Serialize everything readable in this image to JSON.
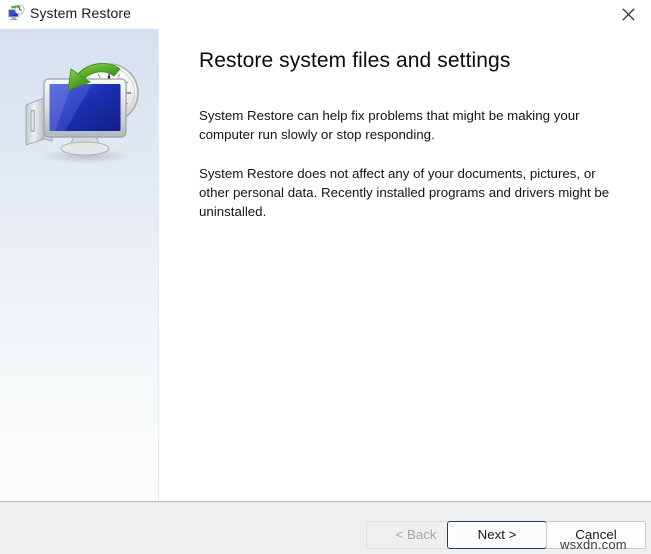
{
  "window": {
    "title": "System Restore",
    "icon": "system-restore-icon",
    "close_label": "✕"
  },
  "sidebar": {
    "illustration": "computer-monitor-clock-restore-illustration"
  },
  "main": {
    "heading": "Restore system files and settings",
    "paragraphs": [
      "System Restore can help fix problems that might be making your computer run slowly or stop responding.",
      "System Restore does not affect any of your documents, pictures, or other personal data. Recently installed programs and drivers might be uninstalled."
    ]
  },
  "footer": {
    "back_label": "< Back",
    "next_label": "Next >",
    "cancel_label": "Cancel"
  },
  "watermark": {
    "text": "wsxdn.com"
  },
  "colors": {
    "sidebar_top": "#d6e0f0",
    "sidebar_bottom": "#fcfcfb",
    "footer_bg": "#efefef",
    "default_button_border": "#1f3d63",
    "disabled_text": "#a6a6a6",
    "body_text": "#141414",
    "monitor_screen": "#1a2fb4",
    "arrow_green": "#5aa832"
  }
}
